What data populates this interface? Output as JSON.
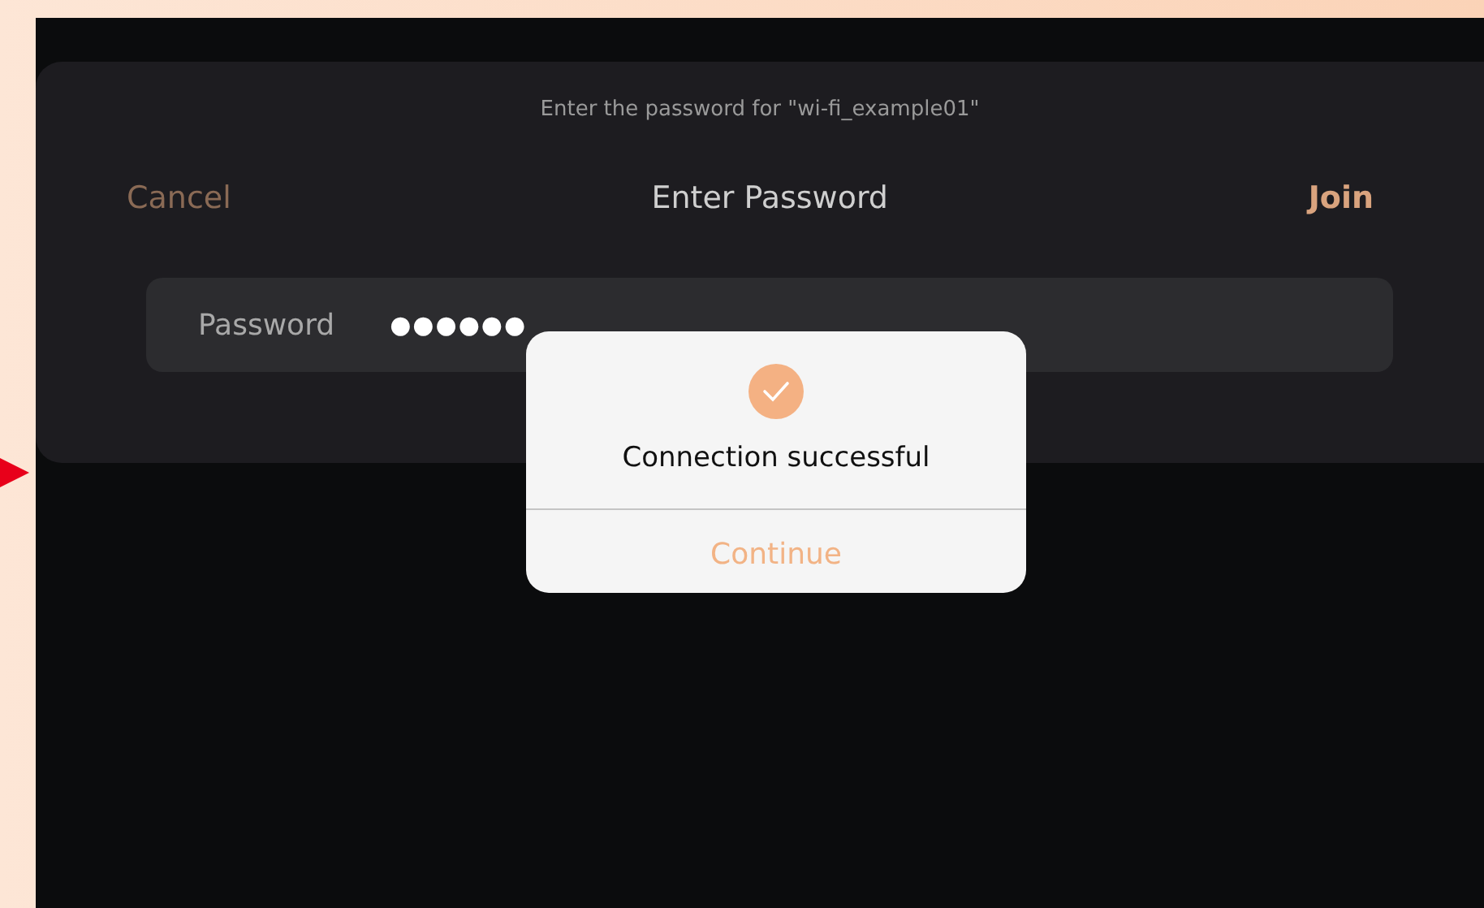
{
  "dialog": {
    "prompt": "Enter the password for \"wi-fi_example01\"",
    "cancel": "Cancel",
    "title": "Enter Password",
    "join": "Join",
    "field_label": "Password",
    "field_value": "●●●●●●"
  },
  "alert": {
    "message": "Connection successful",
    "button": "Continue"
  }
}
